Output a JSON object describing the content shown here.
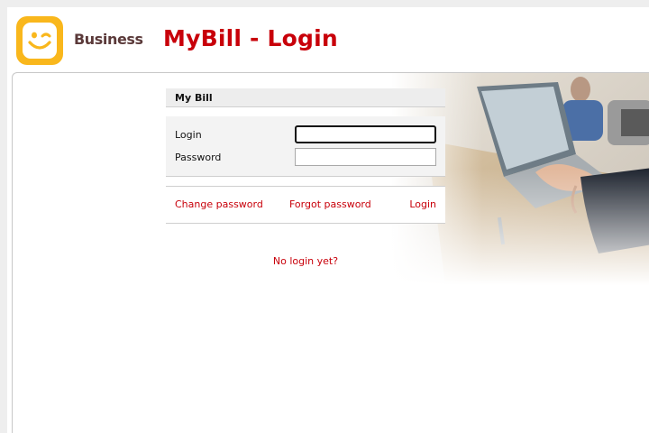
{
  "header": {
    "brand": "Business",
    "title": "MyBill - Login"
  },
  "panel": {
    "title": "My Bill",
    "login_label": "Login",
    "login_value": "",
    "password_label": "Password",
    "password_value": ""
  },
  "links": {
    "change_password": "Change password",
    "forgot_password": "Forgot password",
    "login": "Login",
    "no_login": "No login yet?"
  },
  "colors": {
    "accent_red": "#c8000a",
    "logo_yellow": "#f9b71c",
    "brand_brown": "#5b3a3a"
  },
  "icons": {
    "logo": "smiley-face-icon"
  }
}
